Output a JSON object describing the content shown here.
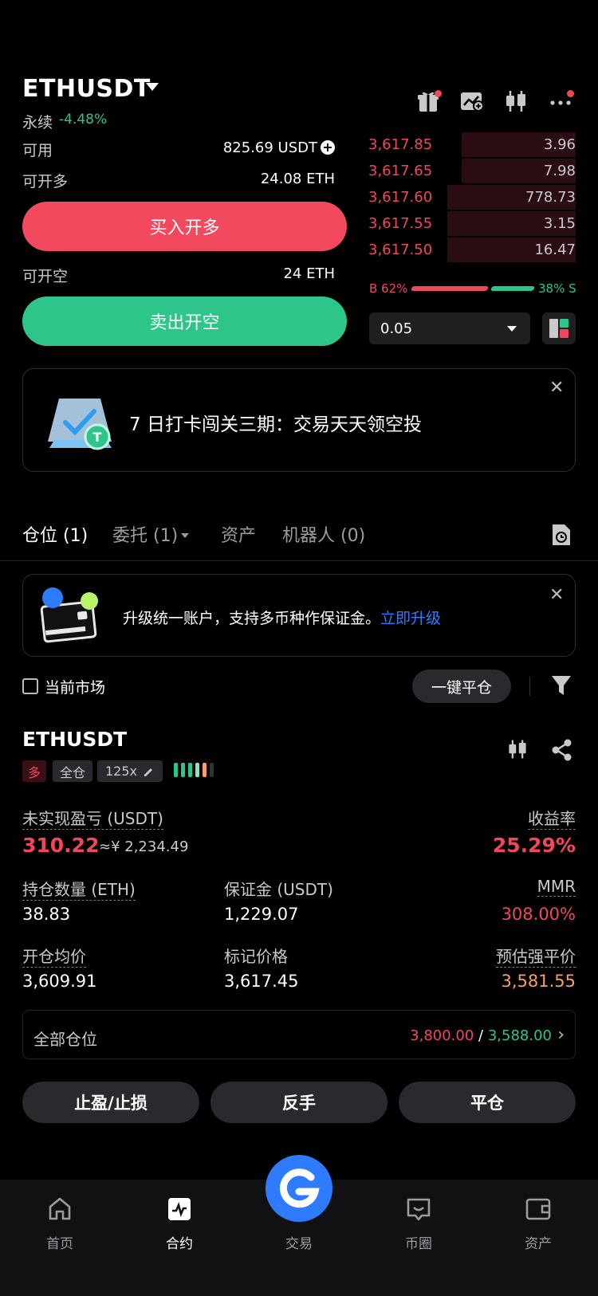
{
  "header": {
    "symbol": "ETHUSDT",
    "contract_type": "永续",
    "change": "-4.48%"
  },
  "account": {
    "available_label": "可用",
    "available_value": "825.69 USDT",
    "open_long_label": "可开多",
    "open_long_value": "24.08 ETH",
    "buy_button": "买入开多",
    "open_short_label": "可开空",
    "open_short_value": "24 ETH",
    "sell_button": "卖出开空"
  },
  "orderbook": {
    "asks": [
      {
        "price": "3,617.85",
        "size": "3.96",
        "depth": 0.55
      },
      {
        "price": "3,617.65",
        "size": "7.98",
        "depth": 0.55
      },
      {
        "price": "3,617.60",
        "size": "778.73",
        "depth": 0.62
      },
      {
        "price": "3,617.55",
        "size": "3.15",
        "depth": 0.62
      },
      {
        "price": "3,617.50",
        "size": "16.47",
        "depth": 0.62
      }
    ],
    "buy_ratio_label": "B 62%",
    "sell_ratio_label": "38% S",
    "buy_ratio": 0.62,
    "sell_ratio": 0.38,
    "quantity": "0.05"
  },
  "promo": {
    "text": "7 日打卡闯关三期：交易天天领空投"
  },
  "tabs": [
    {
      "label": "仓位 (1)"
    },
    {
      "label": "委托 (1)"
    },
    {
      "label": "资产"
    },
    {
      "label": "机器人 (0)"
    }
  ],
  "upgrade": {
    "text": "升级统一账户，支持多币种作保证金。",
    "link": "立即升级"
  },
  "filters": {
    "current_market": "当前市场",
    "close_all": "一键平仓"
  },
  "position": {
    "symbol": "ETHUSDT",
    "side": "多",
    "margin_mode": "全仓",
    "leverage": "125x",
    "unrealized_pnl_label": "未实现盈亏 (USDT)",
    "unrealized_pnl": "310.22",
    "unrealized_pnl_cny": "≈¥ 2,234.49",
    "roe_label": "收益率",
    "roe": "25.29%",
    "size_label": "持仓数量 (ETH)",
    "size": "38.83",
    "margin_label": "保证金 (USDT)",
    "margin": "1,229.07",
    "mmr_label": "MMR",
    "mmr": "308.00%",
    "entry_label": "开仓均价",
    "entry": "3,609.91",
    "mark_label": "标记价格",
    "mark": "3,617.45",
    "liq_label": "预估强平价",
    "liq": "3,581.55",
    "all_positions_label": "全部仓位",
    "tp_value": "3,800.00",
    "slash": "/",
    "sl_value": "3,588.00",
    "btn_tpsl": "止盈/止损",
    "btn_reverse": "反手",
    "btn_close": "平仓"
  },
  "nav": {
    "items": [
      {
        "label": "首页"
      },
      {
        "label": "合约"
      },
      {
        "label": "交易"
      },
      {
        "label": "币圈"
      },
      {
        "label": "资产"
      }
    ]
  },
  "colors": {
    "red": "#f0475a",
    "green": "#2ec58a",
    "blue": "#2f7bff",
    "orange": "#f6a06a"
  }
}
